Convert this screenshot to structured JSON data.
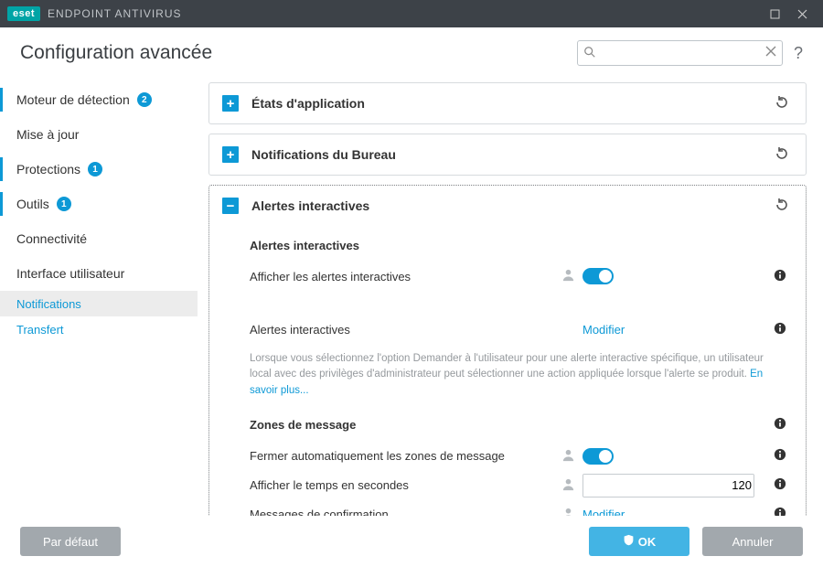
{
  "titlebar": {
    "brand": "eset",
    "product": "ENDPOINT ANTIVIRUS"
  },
  "page_title": "Configuration avancée",
  "search": {
    "placeholder": ""
  },
  "sidebar": {
    "items": [
      {
        "label": "Moteur de détection",
        "badge": "2"
      },
      {
        "label": "Mise à jour"
      },
      {
        "label": "Protections",
        "badge": "1"
      },
      {
        "label": "Outils",
        "badge": "1"
      },
      {
        "label": "Connectivité"
      },
      {
        "label": "Interface utilisateur"
      }
    ],
    "sub": [
      {
        "label": "Notifications"
      },
      {
        "label": "Transfert"
      }
    ]
  },
  "sections": {
    "app_states": {
      "title": "États d'application"
    },
    "desktop_notifications": {
      "title": "Notifications du Bureau"
    },
    "interactive_alerts": {
      "title": "Alertes interactives",
      "sub_alerts_heading": "Alertes interactives",
      "show_interactive_label": "Afficher les alertes interactives",
      "alerts_label": "Alertes interactives",
      "alerts_action": "Modifier",
      "desc_prefix": "Lorsque vous sélectionnez l'option Demander à l'utilisateur pour une alerte interactive spécifique, un utilisateur local avec des privilèges d'administrateur peut sélectionner une action appliquée lorsque l'alerte se produit. ",
      "desc_link": "En savoir plus...",
      "msg_heading": "Zones de message",
      "auto_close_label": "Fermer automatiquement les zones de message",
      "time_label": "Afficher le temps en secondes",
      "time_value": "120",
      "confirm_label": "Messages de confirmation",
      "confirm_action": "Modifier"
    }
  },
  "footer": {
    "default": "Par défaut",
    "ok": "OK",
    "cancel": "Annuler"
  }
}
